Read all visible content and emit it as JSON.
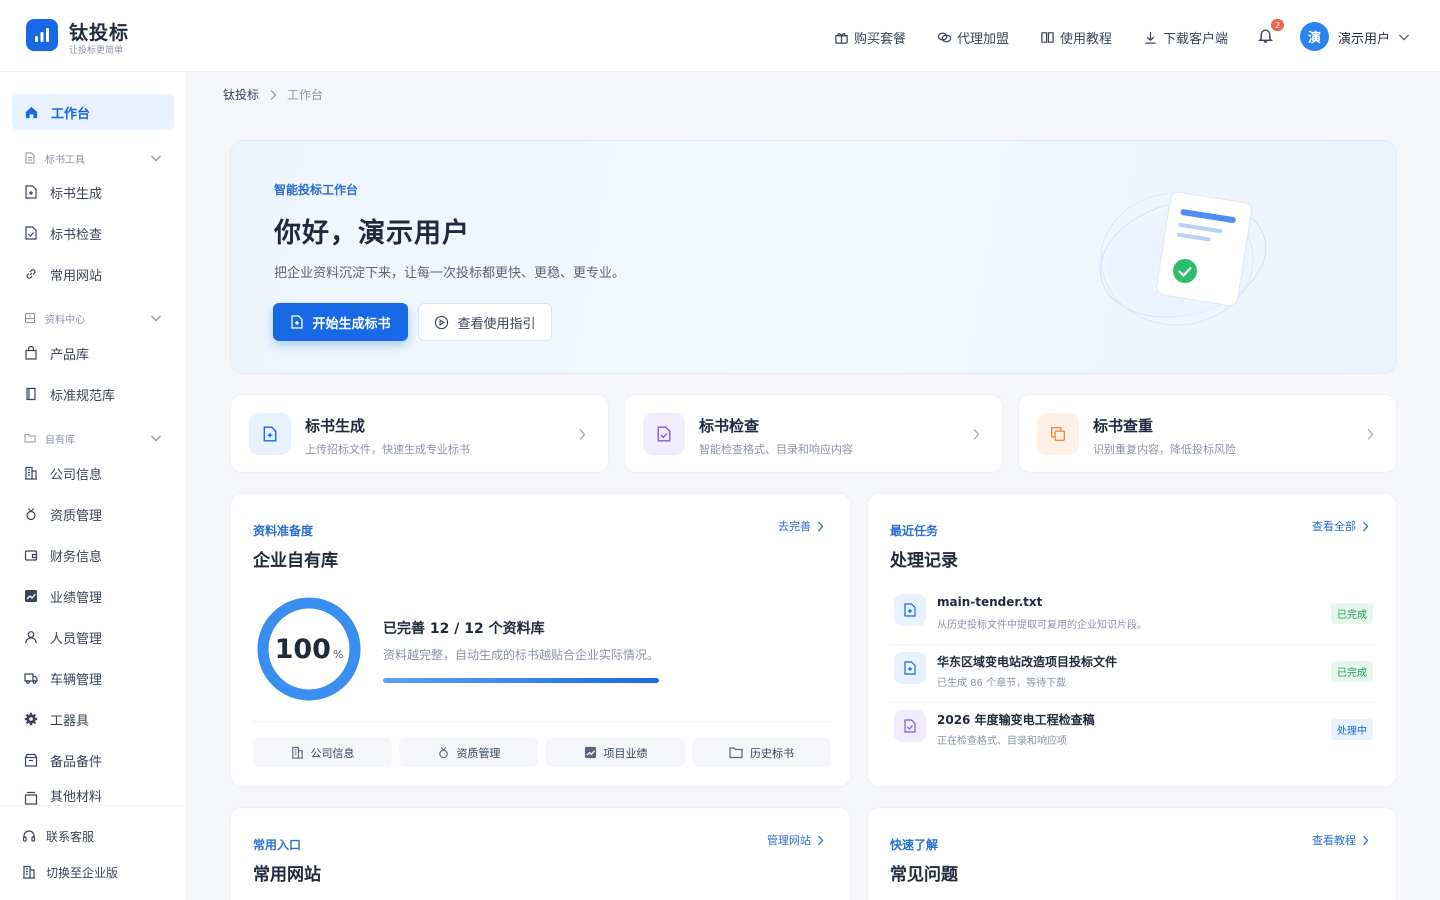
{
  "header": {
    "brand": "钛投标",
    "brand_sub": "让投标更简单",
    "nav": [
      {
        "label": "购买套餐",
        "icon": "gift-icon"
      },
      {
        "label": "代理加盟",
        "icon": "link-icon"
      },
      {
        "label": "使用教程",
        "icon": "book-icon"
      },
      {
        "label": "下载客户端",
        "icon": "download-icon"
      }
    ],
    "notification_count": "2",
    "avatar_char": "演",
    "user_name": "演示用户"
  },
  "sidebar": {
    "workbench": "工作台",
    "groups": [
      {
        "title": "标书工具",
        "items": [
          "标书生成",
          "标书检查",
          "常用网站"
        ]
      },
      {
        "title": "资料中心",
        "items": [
          "产品库",
          "标准规范库"
        ]
      },
      {
        "title": "自有库",
        "items": [
          "公司信息",
          "资质管理",
          "财务信息",
          "业绩管理",
          "人员管理",
          "车辆管理",
          "工器具",
          "备品备件",
          "其他材料"
        ]
      }
    ],
    "footer": [
      "联系客服",
      "切换至企业版"
    ]
  },
  "breadcrumb": [
    "钛投标",
    "工作台"
  ],
  "hero": {
    "tag": "智能投标工作台",
    "title": "你好，演示用户",
    "desc": "把企业资料沉淀下来，让每一次投标都更快、更稳、更专业。",
    "primary_button": "开始生成标书",
    "secondary_button": "查看使用指引"
  },
  "quick_cards": [
    {
      "title": "标书生成",
      "desc": "上传招标文件，快速生成专业标书",
      "icon": "file-plus-icon",
      "tint": "#e8f1fe",
      "color": "#1769e6"
    },
    {
      "title": "标书检查",
      "desc": "智能检查格式、目录和响应内容",
      "icon": "file-check-icon",
      "tint": "#f0ecfd",
      "color": "#7b5ce0"
    },
    {
      "title": "标书查重",
      "desc": "识别重复内容，降低投标风险",
      "icon": "copy-icon",
      "tint": "#fdf0e6",
      "color": "#f08a3c"
    }
  ],
  "readiness": {
    "tag": "资料准备度",
    "title": "企业自有库",
    "link": "去完善",
    "percent": 100,
    "percent_label": "100",
    "percent_unit": "%",
    "progress_title": "已完善 12 / 12 个资料库",
    "progress_desc": "资料越完整，自动生成的标书越贴合企业实际情况。",
    "progress_fraction": 1,
    "chips": [
      "公司信息",
      "资质管理",
      "项目业绩",
      "历史标书"
    ]
  },
  "tasks": {
    "tag": "最近任务",
    "title": "处理记录",
    "link": "查看全部",
    "items": [
      {
        "name": "main-tender.txt",
        "desc": "从历史投标文件中提取可复用的企业知识片段。",
        "status": "已完成",
        "state": "done"
      },
      {
        "name": "华东区域变电站改造项目投标文件",
        "desc": "已生成 86 个章节，等待下载",
        "status": "已完成",
        "state": "done"
      },
      {
        "name": "2026 年度输变电工程检查稿",
        "desc": "正在检查格式、目录和响应项",
        "status": "处理中",
        "state": "processing"
      }
    ]
  },
  "sites": {
    "tag": "常用入口",
    "title": "常用网站",
    "link": "管理网站"
  },
  "faq": {
    "tag": "快速了解",
    "title": "常见问题",
    "link": "查看教程"
  },
  "colors": {
    "accent": "#1769e6",
    "success": "#1e9a53"
  }
}
